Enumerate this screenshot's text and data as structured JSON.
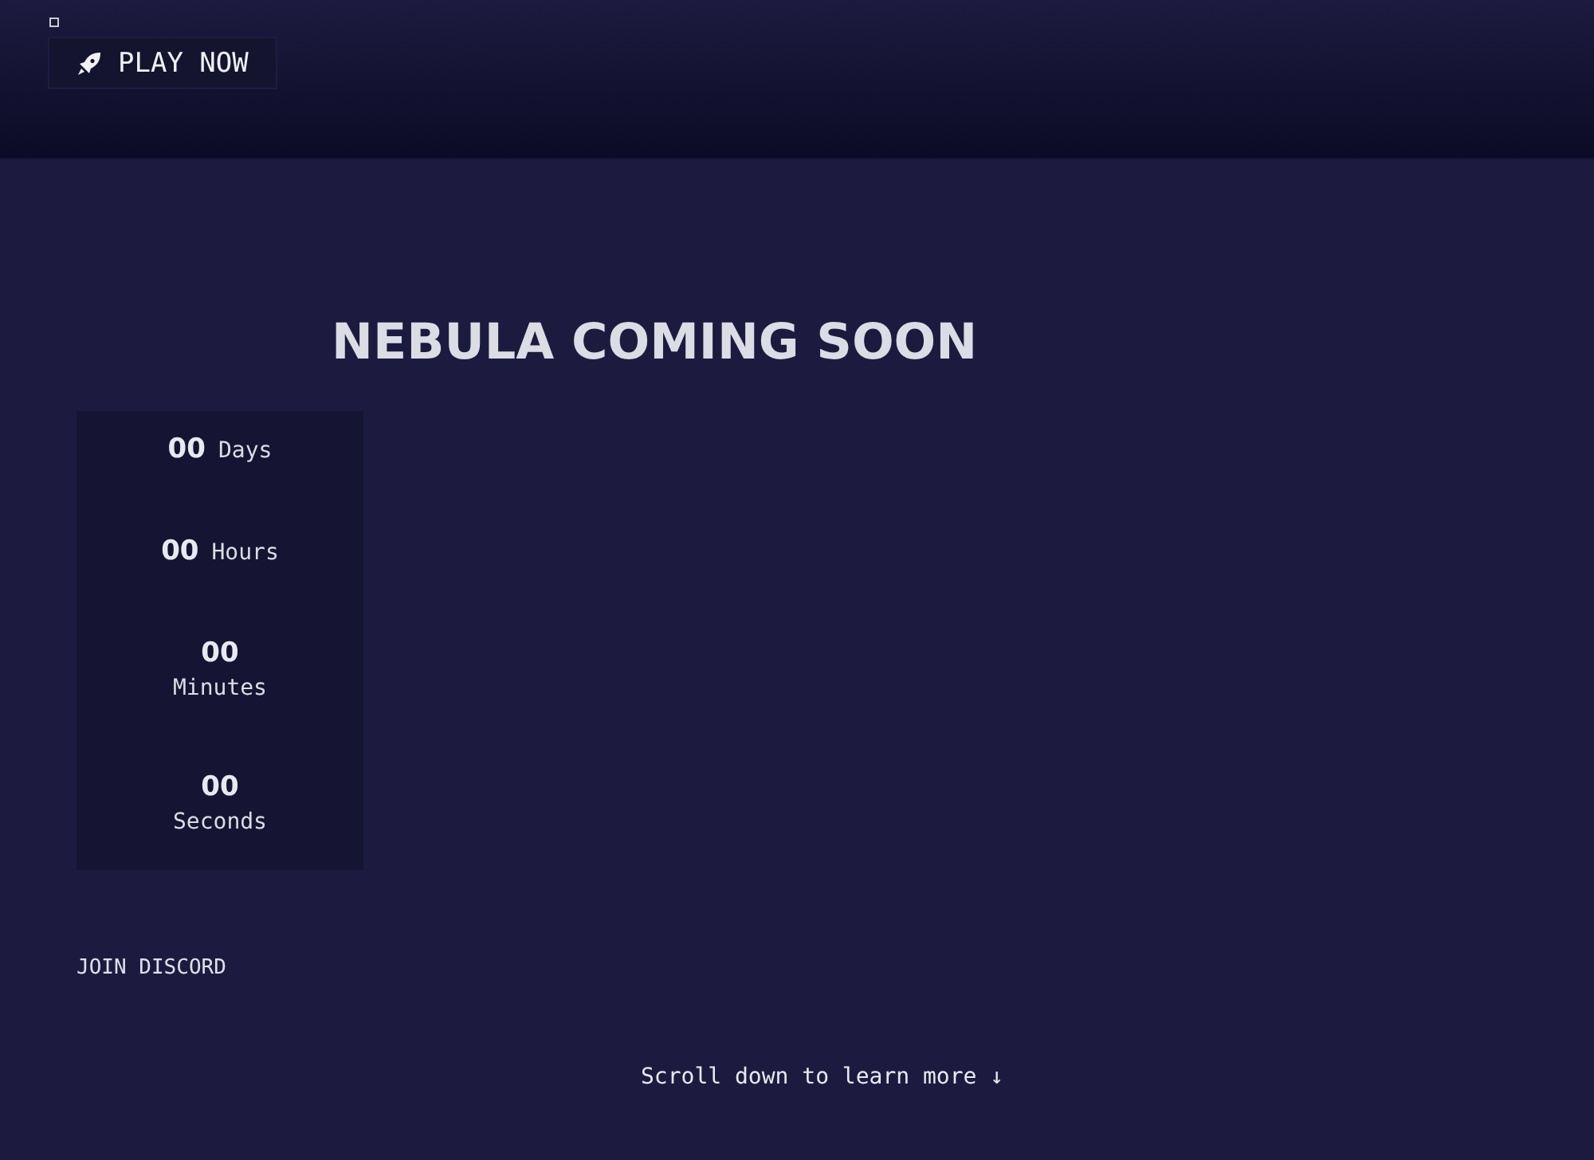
{
  "header": {
    "play_button": "PLAY NOW"
  },
  "title": "NEBULA COMING SOON",
  "countdown": [
    {
      "value": "00",
      "unit": "Days",
      "kind": "inline"
    },
    {
      "value": "00",
      "unit": "Hours",
      "kind": "inline"
    },
    {
      "value": "00",
      "unit": "Minutes",
      "kind": "stacked"
    },
    {
      "value": "00",
      "unit": "Seconds",
      "kind": "stacked"
    }
  ],
  "discord_link": "JOIN DISCORD",
  "scroll_hint": "Scroll down to learn more ↓"
}
